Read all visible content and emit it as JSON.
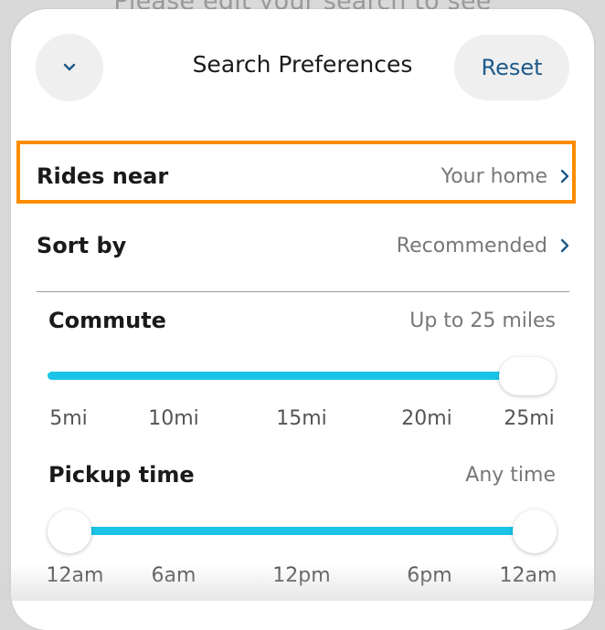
{
  "background_text": "Please edit your search to see",
  "header": {
    "title": "Search Preferences",
    "reset_label": "Reset",
    "collapse_icon": "chevron-down-icon"
  },
  "rows": {
    "rides_near": {
      "label": "Rides near",
      "value": "Your home",
      "icon": "chevron-right-icon"
    },
    "sort_by": {
      "label": "Sort by",
      "value": "Recommended",
      "icon": "chevron-right-icon"
    }
  },
  "commute": {
    "label": "Commute",
    "value": "Up to 25 miles",
    "ticks": [
      "5mi",
      "10mi",
      "15mi",
      "20mi",
      "25mi"
    ],
    "selected_max": "25mi"
  },
  "pickup_time": {
    "label": "Pickup time",
    "value": "Any time",
    "ticks": [
      "12am",
      "6am",
      "12pm",
      "6pm",
      "12am"
    ],
    "selected_start": "12am",
    "selected_end": "12am"
  },
  "colors": {
    "accent": "#1ac4e6",
    "link": "#1c5a8a",
    "highlight": "#ff8c00"
  }
}
